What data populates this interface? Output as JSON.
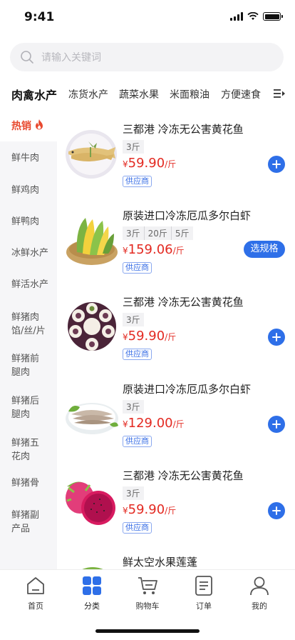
{
  "status_bar": {
    "time": "9:41"
  },
  "search": {
    "placeholder": "请输入关键词"
  },
  "category_tabs": [
    {
      "label": "肉禽水产",
      "active": true
    },
    {
      "label": "冻货水产"
    },
    {
      "label": "蔬菜水果"
    },
    {
      "label": "米面粮油"
    },
    {
      "label": "方便速食"
    }
  ],
  "sidebar": {
    "items": [
      {
        "label": "热销",
        "active": true,
        "icon": "fire-icon"
      },
      {
        "label": "鲜牛肉"
      },
      {
        "label": "鲜鸡肉"
      },
      {
        "label": "鲜鸭肉"
      },
      {
        "label": "冰鲜水产"
      },
      {
        "label": "鲜活水产"
      },
      {
        "label": "鲜猪肉馅/丝/片"
      },
      {
        "label": "鲜猪前腿肉"
      },
      {
        "label": "鲜猪后腿肉"
      },
      {
        "label": "鲜猪五花肉"
      },
      {
        "label": "鲜猪骨"
      },
      {
        "label": "鲜猪副产品"
      }
    ]
  },
  "products": [
    {
      "title": "三都港 冷冻无公害黄花鱼",
      "specs": [
        "3斤"
      ],
      "yen": "¥",
      "price": "59.90",
      "unit": "/斤",
      "tag": "供应商",
      "action": "add",
      "image": "fish-plate"
    },
    {
      "title": "原装进口冷冻厄瓜多尔白虾",
      "specs": [
        "3斤",
        "20斤",
        "5斤"
      ],
      "yen": "¥",
      "price": "159.06",
      "unit": "/斤",
      "tag": "供应商",
      "action": "spec",
      "action_label": "选规格",
      "image": "corn-basket"
    },
    {
      "title": "三都港 冷冻无公害黄花鱼",
      "specs": [
        "3斤"
      ],
      "yen": "¥",
      "price": "59.90",
      "unit": "/斤",
      "tag": "供应商",
      "action": "add",
      "image": "mangosteen"
    },
    {
      "title": "原装进口冷冻厄瓜多尔白虾",
      "specs": [
        "3斤"
      ],
      "yen": "¥",
      "price": "129.00",
      "unit": "/斤",
      "tag": "供应商",
      "action": "add",
      "image": "shrimp-plate"
    },
    {
      "title": "三都港 冷冻无公害黄花鱼",
      "specs": [
        "3斤"
      ],
      "yen": "¥",
      "price": "59.90",
      "unit": "/斤",
      "tag": "供应商",
      "action": "add",
      "image": "dragon-fruit"
    },
    {
      "title": "鲜太空水果莲蓬",
      "image": "lotus-pod"
    }
  ],
  "tab_bar": [
    {
      "label": "首页",
      "icon": "home-icon",
      "active": false
    },
    {
      "label": "分类",
      "icon": "category-icon",
      "active": true
    },
    {
      "label": "购物车",
      "icon": "cart-icon",
      "active": false
    },
    {
      "label": "订单",
      "icon": "order-icon",
      "active": false
    },
    {
      "label": "我的",
      "icon": "user-icon",
      "active": false
    }
  ],
  "colors": {
    "accent": "#2e6fe8",
    "price": "#e32a22",
    "hot": "#e8492f",
    "sidebar_bg": "#f6f6f8"
  }
}
